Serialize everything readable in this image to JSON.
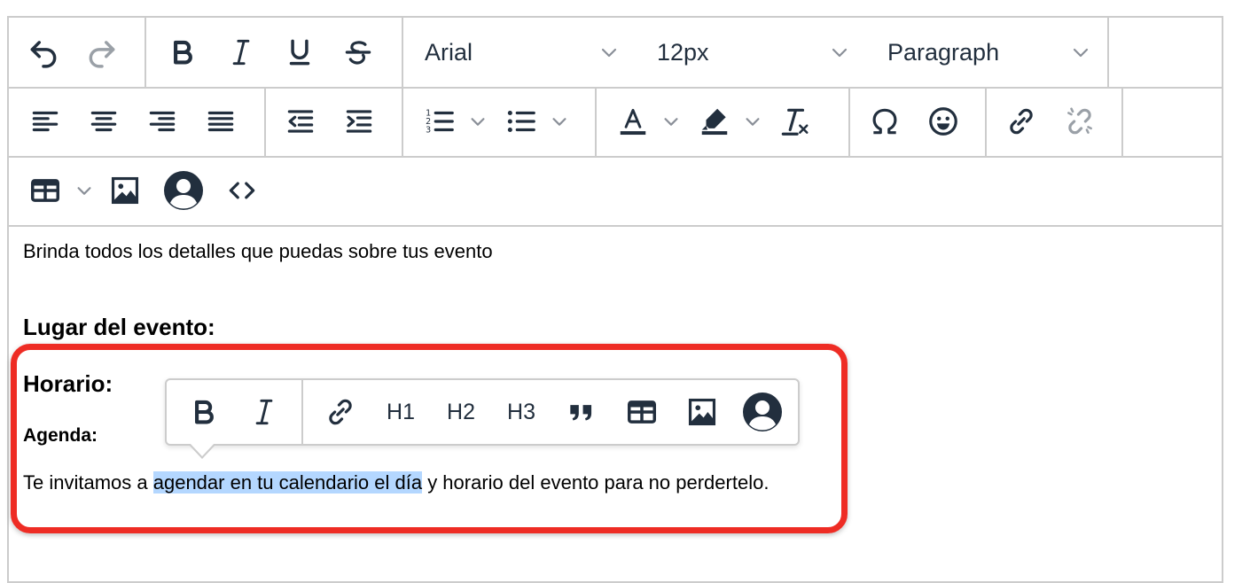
{
  "toolbar": {
    "font_family": "Arial",
    "font_size": "12px",
    "block_format": "Paragraph"
  },
  "content": {
    "intro": "Brinda todos los detalles que puedas sobre tus evento",
    "heading_lugar": "Lugar del evento:",
    "heading_horario": "Horario:",
    "heading_agenda": "Agenda:",
    "para_before": "Te invitamos a ",
    "para_selected": "agendar en tu calendario el día",
    "para_after": " y horario del evento para no perdertelo."
  },
  "quickbar": {
    "h1": "H1",
    "h2": "H2",
    "h3": "H3"
  },
  "colors": {
    "icon": "#222f3e",
    "border": "#cccccc",
    "selection": "#b4d7ff",
    "annotation": "#ee2c24"
  }
}
